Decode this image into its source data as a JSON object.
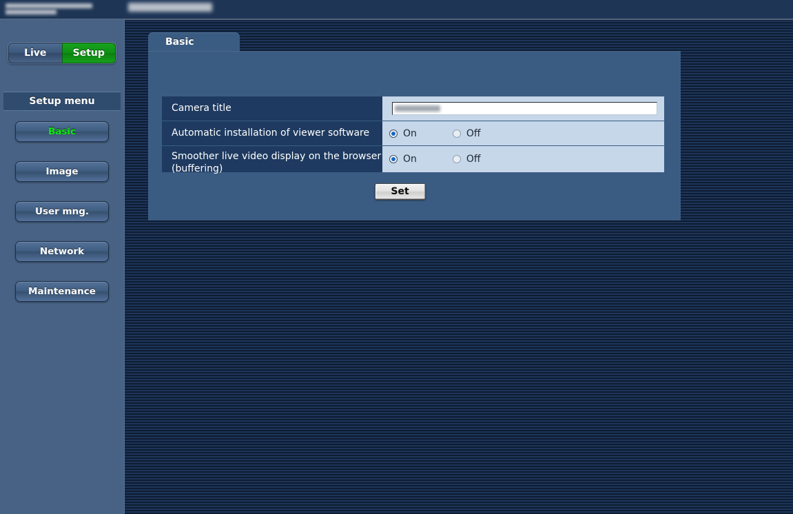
{
  "header": {
    "brand_logo": "redacted-brand-logo",
    "device_title": "redacted-device-model"
  },
  "sidebar": {
    "mode_toggle": {
      "live_label": "Live",
      "setup_label": "Setup",
      "selected": "Setup"
    },
    "menu_heading": "Setup menu",
    "items": [
      {
        "label": "Basic",
        "active": true
      },
      {
        "label": "Image",
        "active": false
      },
      {
        "label": "User mng.",
        "active": false
      },
      {
        "label": "Network",
        "active": false
      },
      {
        "label": "Maintenance",
        "active": false
      }
    ]
  },
  "main": {
    "tabs": [
      {
        "label": "Basic",
        "active": true
      }
    ],
    "settings": {
      "camera_title": {
        "label": "Camera title",
        "value": "redacted-camera-title",
        "placeholder": ""
      },
      "auto_install_viewer": {
        "label": "Automatic installation of viewer software",
        "on_label": "On",
        "off_label": "Off",
        "selected": "On"
      },
      "smoother_live_video": {
        "label": "Smoother live video display on the browser (buffering)",
        "label_line1": "Smoother live video display on the browser",
        "label_line2": "(buffering)",
        "on_label": "On",
        "off_label": "Off",
        "selected": "On"
      }
    },
    "set_button_label": "Set"
  },
  "colors": {
    "accent_green": "#0ee80e",
    "setup_button_green": "#0f9015",
    "panel_blue": "#3b5c82",
    "sidebar_blue": "#476284",
    "row_label_navy": "#1e3a60",
    "row_value_light": "#c6d7ea",
    "stripe_dark": "#0e1c33",
    "stripe_light": "#1d3558"
  }
}
